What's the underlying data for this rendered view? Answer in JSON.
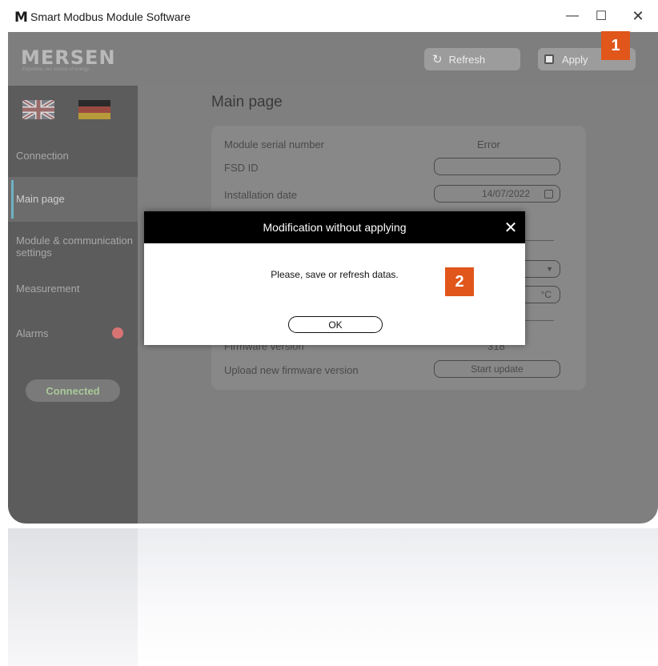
{
  "window": {
    "app_logo": "M",
    "title": "Smart Modbus Module Software",
    "minimize": "—",
    "maximize": "☐",
    "close": "✕"
  },
  "header": {
    "brand": "MERSEN",
    "tagline": "Expertise, our source of energy",
    "refresh_icon": "refresh-icon",
    "refresh_symbol": "↻",
    "refresh_label": "Refresh",
    "apply_label": "Apply",
    "colors": {
      "header_bg": "#7e7e7e",
      "sidebar_bg": "#5c5c5c",
      "accent": "#6fb2c6"
    }
  },
  "annotations": {
    "badge1": "1",
    "badge2": "2",
    "badge_color": "#e0561b"
  },
  "sidebar": {
    "items": [
      {
        "label": "Connection"
      },
      {
        "label": "Main page",
        "active": true
      },
      {
        "label": "Module & communication settings"
      },
      {
        "label": "Measurement"
      },
      {
        "label": "Alarms"
      }
    ],
    "status": "Connected"
  },
  "main": {
    "title": "Main page",
    "rows": {
      "serial_label": "Module serial number",
      "serial_value": "Error",
      "fsd_label": "FSD ID",
      "fsd_value": "",
      "install_label": "Installation date",
      "install_value": "14/07/2022",
      "temp_unit": "°C",
      "firmware_label": "Firmware version",
      "firmware_value": "318",
      "upload_label": "Upload new firmware version",
      "upload_button": "Start update"
    }
  },
  "dialog": {
    "title": "Modification without applying",
    "close": "✕",
    "message": "Please, save or refresh datas.",
    "ok": "OK"
  }
}
